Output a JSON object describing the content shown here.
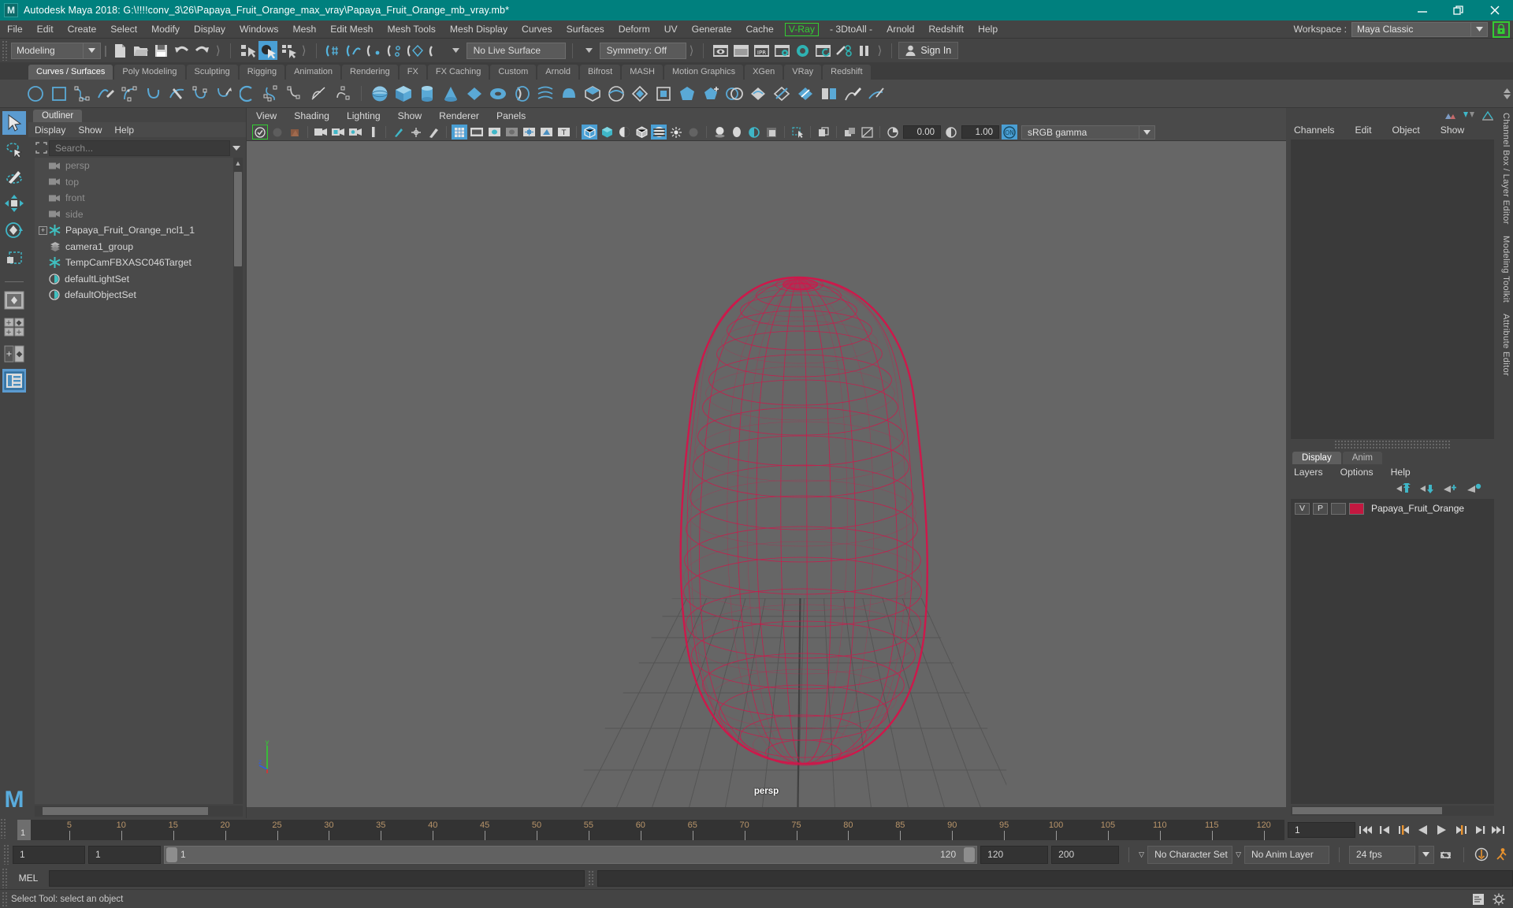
{
  "titlebar": {
    "app_title": "Autodesk Maya 2018: G:\\!!!!conv_3\\26\\Papaya_Fruit_Orange_max_vray\\Papaya_Fruit_Orange_mb_vray.mb*",
    "logo_text": "M",
    "minimize": "minimize-icon",
    "restore": "restore-icon",
    "close": "close-icon",
    "bg_color": "#00807e"
  },
  "menubar": {
    "items": [
      "File",
      "Edit",
      "Create",
      "Select",
      "Modify",
      "Display",
      "Windows",
      "Mesh",
      "Edit Mesh",
      "Mesh Tools",
      "Mesh Display",
      "Curves",
      "Surfaces",
      "Deform",
      "UV",
      "Generate",
      "Cache"
    ],
    "vray": "V-Ray",
    "items_after": [
      "- 3DtoAll -",
      "Arnold",
      "Redshift",
      "Help"
    ],
    "vray_color": "#33cc33",
    "workspace_label": "Workspace :",
    "workspace_value": "Maya Classic",
    "lock_icon": "lock-icon"
  },
  "statusbar": {
    "mode": "Modeling",
    "live_surface": "No Live Surface",
    "symmetry": "Symmetry: Off",
    "signin": "Sign In"
  },
  "shelf": {
    "tabs": [
      "Curves / Surfaces",
      "Poly Modeling",
      "Sculpting",
      "Rigging",
      "Animation",
      "Rendering",
      "FX",
      "FX Caching",
      "Custom",
      "Arnold",
      "Bifrost",
      "MASH",
      "Motion Graphics",
      "XGen",
      "VRay",
      "Redshift"
    ],
    "selected_tab": "Curves / Surfaces",
    "icons": [
      "circle-icon",
      "square-icon",
      "cv-curve-icon",
      "pencil-curve-icon",
      "ep-curve-icon",
      "bezier-curve-icon",
      "arc-icon",
      "curve-knife-icon",
      "curve-edit-icon",
      "attach-curve-icon",
      "detach-curve-icon",
      "offset-curve-icon",
      "cv-hardness-icon",
      "curve-fillet-icon",
      "insert-knot-icon",
      "sphere-icon",
      "cube-icon",
      "cylinder-icon",
      "cone-icon",
      "plane-icon",
      "torus-icon",
      "revolve-icon",
      "loft-icon",
      "planar-icon",
      "extrude-icon",
      "birail-icon",
      "boundary-icon",
      "square-surface-icon",
      "bevel-icon",
      "bevel-plus-icon",
      "intersect-icon",
      "project-curve-icon",
      "trim-icon",
      "untrim-icon",
      "stitch-icon",
      "sculpt-geometry-icon",
      "surface-editor-icon"
    ]
  },
  "toolbox": {
    "items": [
      "select-tool-icon",
      "lasso-tool-icon",
      "paint-select-tool-icon",
      "move-tool-icon",
      "rotate-tool-icon",
      "scale-tool-icon"
    ],
    "layout_items": [
      "single-perspective-layout-icon",
      "four-view-layout-icon",
      "two-pane-layout-icon",
      "outliner-persp-layout-icon"
    ],
    "selected": "select-tool-icon",
    "selected_layout": "outliner-persp-layout-icon",
    "logo": "M"
  },
  "outliner": {
    "tab": "Outliner",
    "menu": [
      "Display",
      "Show",
      "Help"
    ],
    "search_placeholder": "Search...",
    "search_value": "",
    "items": [
      {
        "label": "persp",
        "icon": "camera-icon",
        "dim": true,
        "indent": 0,
        "expander": false
      },
      {
        "label": "top",
        "icon": "camera-icon",
        "dim": true,
        "indent": 0,
        "expander": false
      },
      {
        "label": "front",
        "icon": "camera-icon",
        "dim": true,
        "indent": 0,
        "expander": false
      },
      {
        "label": "side",
        "icon": "camera-icon",
        "dim": true,
        "indent": 0,
        "expander": false
      },
      {
        "label": "Papaya_Fruit_Orange_ncl1_1",
        "icon": "transform-icon",
        "dim": false,
        "indent": 0,
        "expander": true
      },
      {
        "label": "camera1_group",
        "icon": "group-icon",
        "dim": false,
        "indent": 0,
        "expander": false
      },
      {
        "label": "TempCamFBXASC046Target",
        "icon": "transform-icon",
        "dim": false,
        "indent": 0,
        "expander": false
      },
      {
        "label": "defaultLightSet",
        "icon": "set-icon",
        "dim": false,
        "indent": 0,
        "expander": false
      },
      {
        "label": "defaultObjectSet",
        "icon": "set-icon",
        "dim": false,
        "indent": 0,
        "expander": false
      }
    ]
  },
  "viewport": {
    "menu": [
      "View",
      "Shading",
      "Lighting",
      "Show",
      "Renderer",
      "Panels"
    ],
    "exposure_value": "0.00",
    "gamma_value": "1.00",
    "color_space": "sRGB gamma",
    "camera_label": "persp",
    "axis": {
      "x": "x",
      "y": "y",
      "z": "z",
      "x_color": "#e03030",
      "y_color": "#30d030",
      "z_color": "#3060e0"
    },
    "model_wire_color": "#d4144a",
    "background_color": "#666666"
  },
  "right_panel": {
    "menu": [
      "Channels",
      "Edit",
      "Object",
      "Show"
    ],
    "rail_labels": [
      "Channel Box / Layer Editor",
      "Modeling Toolkit",
      "Attribute Editor"
    ]
  },
  "layers": {
    "tabs": [
      "Display",
      "Anim"
    ],
    "selected_tab": "Display",
    "menu": [
      "Layers",
      "Options",
      "Help"
    ],
    "buttons": [
      "move-layer-up-icon",
      "move-layer-down-icon",
      "new-layer-icon",
      "new-layer-from-selected-icon"
    ],
    "rows": [
      {
        "visibility": "V",
        "playback": "P",
        "state": "",
        "color": "#c31840",
        "name": "Papaya_Fruit_Orange"
      }
    ]
  },
  "timeline": {
    "current_frame": "1",
    "ticks": [
      5,
      10,
      15,
      20,
      25,
      30,
      35,
      40,
      45,
      50,
      55,
      60,
      65,
      70,
      75,
      80,
      85,
      90,
      95,
      100,
      105,
      110,
      115,
      120
    ],
    "tick_color": "#b9956a",
    "frame_field": "1",
    "playback_buttons": [
      "go-to-start-icon",
      "step-back-keyframe-icon",
      "step-back-frame-icon",
      "play-backwards-icon",
      "play-forwards-icon",
      "step-forward-frame-icon",
      "step-forward-keyframe-icon",
      "go-to-end-icon"
    ]
  },
  "range": {
    "start_field": "1",
    "range_start_field": "1",
    "slider_min": "1",
    "slider_max": "120",
    "range_end_field": "120",
    "end_field": "200",
    "character_set": "No Character Set",
    "anim_layer": "No Anim Layer",
    "fps": "24 fps",
    "loop_icon": "loop-icon",
    "anim_pref_icon": "animation-preferences-icon",
    "char_icon": "character-icon"
  },
  "command_line": {
    "label": "MEL",
    "input_value": "",
    "output_value": ""
  },
  "status_line": {
    "text": "Select Tool: select an object"
  }
}
